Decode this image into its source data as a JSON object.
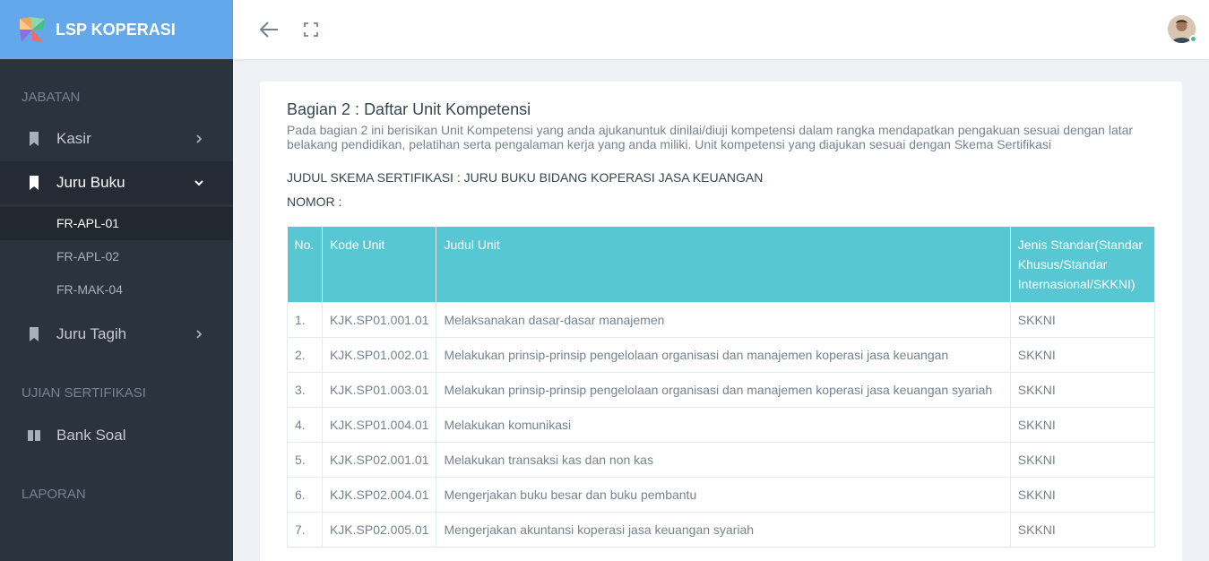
{
  "brand": {
    "title": "LSP KOPERASI"
  },
  "sidebar": {
    "section_jabatan": "JABATAN",
    "kasir": "Kasir",
    "juru_buku": "Juru Buku",
    "sub_items": [
      "FR-APL-01",
      "FR-APL-02",
      "FR-MAK-04"
    ],
    "juru_tagih": "Juru Tagih",
    "section_ujian": "UJIAN SERTIFIKASI",
    "bank_soal": "Bank Soal",
    "section_laporan": "LAPORAN"
  },
  "content": {
    "title": "Bagian 2 : Daftar Unit Kompetensi",
    "description": "Pada bagian 2 ini berisikan Unit Kompetensi yang anda ajukanuntuk dinilai/diuji kompetensi dalam rangka mendapatkan pengakuan sesuai dengan latar belakang pendidikan, pelatihan serta pengalaman kerja yang anda miliki. Unit kompetensi yang diajukan sesuai dengan Skema Sertifikasi",
    "scheme": "JUDUL SKEMA SERTIFIKASI : JURU BUKU BIDANG KOPERASI JASA KEUANGAN",
    "nomor": "NOMOR :"
  },
  "table": {
    "headers": [
      "No.",
      "Kode Unit",
      "Judul Unit",
      "Jenis Standar(Standar Khusus/Standar Internasional/SKKNI)"
    ],
    "rows": [
      [
        "1.",
        "KJK.SP01.001.01",
        "Melaksanakan dasar-dasar manajemen",
        "SKKNI"
      ],
      [
        "2.",
        "KJK.SP01.002.01",
        "Melakukan prinsip-prinsip pengelolaan organisasi dan manajemen koperasi jasa keuangan",
        "SKKNI"
      ],
      [
        "3.",
        "KJK.SP01.003.01",
        "Melakukan prinsip-prinsip pengelolaan organisasi dan manajemen koperasi jasa keuangan syariah",
        "SKKNI"
      ],
      [
        "4.",
        "KJK.SP01.004.01",
        "Melakukan komunikasi",
        "SKKNI"
      ],
      [
        "5.",
        "KJK.SP02.001.01",
        "Melakukan transaksi kas dan non kas",
        "SKKNI"
      ],
      [
        "6.",
        "KJK.SP02.004.01",
        "Mengerjakan buku besar dan buku pembantu",
        "SKKNI"
      ],
      [
        "7.",
        "KJK.SP02.005.01",
        "Mengerjakan akuntansi koperasi jasa keuangan syariah",
        "SKKNI"
      ]
    ]
  }
}
